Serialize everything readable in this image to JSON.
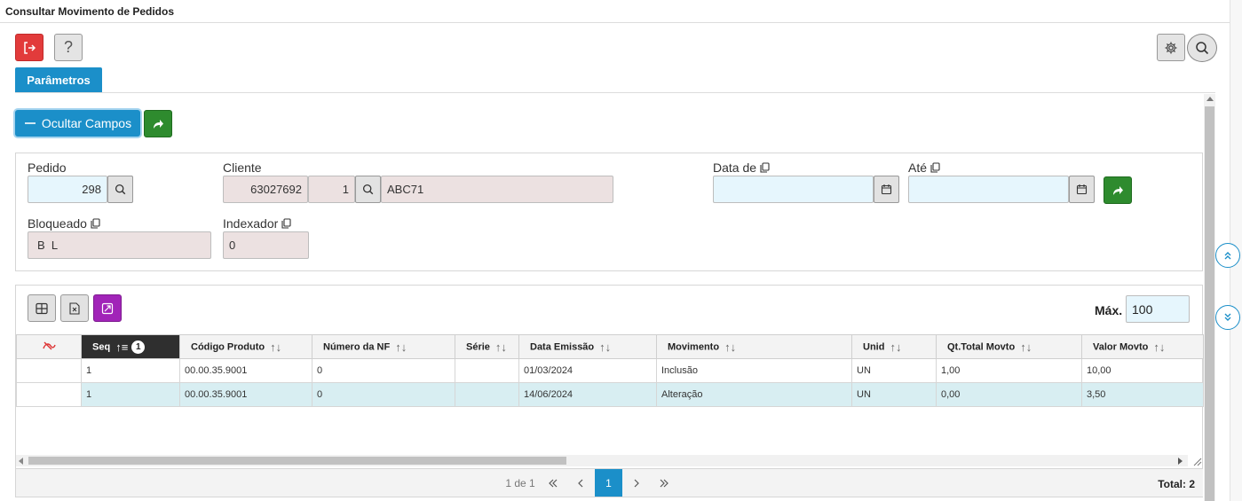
{
  "window": {
    "title": "Consultar Movimento de Pedidos"
  },
  "toolbar": {
    "help_label": "?"
  },
  "tabs": [
    {
      "label": "Parâmetros"
    }
  ],
  "actions": {
    "ocultar_label": "Ocultar Campos"
  },
  "fields": {
    "pedido": {
      "label": "Pedido",
      "value": "298"
    },
    "cliente": {
      "label": "Cliente",
      "codigo": "63027692",
      "loja": "1",
      "nome": "ABC71"
    },
    "data_de": {
      "label": "Data de",
      "value": ""
    },
    "ate": {
      "label": "Até",
      "value": ""
    },
    "bloqueado": {
      "label": "Bloqueado",
      "value": "B  L"
    },
    "indexador": {
      "label": "Indexador",
      "value": "0"
    }
  },
  "grid": {
    "max_label": "Máx.",
    "max_value": "100",
    "sort_badge": "1",
    "columns": [
      "Seq",
      "Código Produto",
      "Número da NF",
      "Série",
      "Data Emissão",
      "Movimento",
      "Unid",
      "Qt.Total Movto",
      "Valor Movto"
    ],
    "rows": [
      [
        "1",
        "00.00.35.9001",
        "0",
        "",
        "01/03/2024",
        "Inclusão",
        "UN",
        "1,00",
        "10,00"
      ],
      [
        "1",
        "00.00.35.9001",
        "0",
        "",
        "14/06/2024",
        "Alteração",
        "UN",
        "0,00",
        "3,50"
      ]
    ],
    "selected_row": 1
  },
  "pagination": {
    "page_info": "1 de 1",
    "current_page": "1",
    "total": "Total: 2"
  },
  "colors": {
    "accent": "#1b8fc9",
    "danger": "#e23b3b",
    "success": "#2e8b2e",
    "purple": "#a124b8"
  },
  "icons": [
    "exit-icon",
    "help-icon",
    "gear-icon",
    "search-icon",
    "minus-icon",
    "share-icon",
    "calendar-icon",
    "copy-icon",
    "columns-icon",
    "excel-icon",
    "expand-icon",
    "clear-filter-icon",
    "sort-icon",
    "scroll-up-icon",
    "scroll-down-icon"
  ]
}
